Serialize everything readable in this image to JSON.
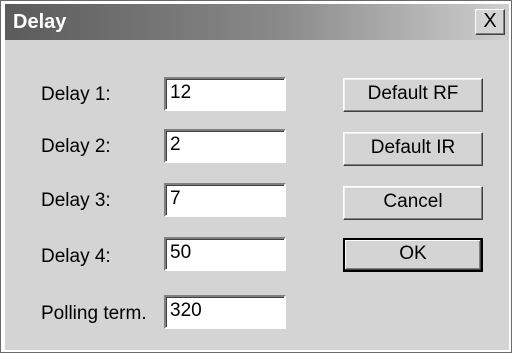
{
  "dialog": {
    "title": "Delay",
    "close_label": "X"
  },
  "fields": [
    {
      "label": "Delay 1:",
      "value": "12"
    },
    {
      "label": "Delay 2:",
      "value": "2"
    },
    {
      "label": "Delay 3:",
      "value": "7"
    },
    {
      "label": "Delay 4:",
      "value": "50"
    },
    {
      "label": "Polling term.",
      "value": "320"
    }
  ],
  "buttons": {
    "default_rf": "Default RF",
    "default_ir": "Default IR",
    "cancel": "Cancel",
    "ok": "OK"
  }
}
